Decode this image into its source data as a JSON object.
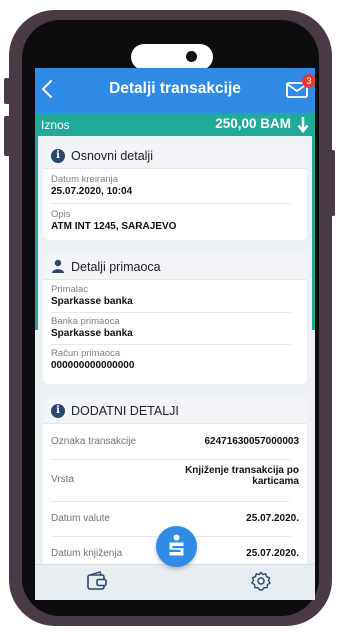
{
  "header": {
    "title": "Detalji transakcije",
    "mail_badge": "3"
  },
  "amount": {
    "label": "Iznos",
    "value": "250,00 BAM"
  },
  "basic_details": {
    "title": "Osnovni detalji",
    "created_label": "Datum kreiranja",
    "created_value": "25.07.2020, 10:04",
    "desc_label": "Opis",
    "desc_value": "ATM INT 1245, SARAJEVO"
  },
  "recipient": {
    "title": "Detalji primaoca",
    "recipient_label": "Primalac",
    "recipient_value": "Sparkasse banka",
    "bank_label": "Banka primaoca",
    "bank_value": "Sparkasse banka",
    "account_label": "Račun primaoca",
    "account_value": "000000000000000"
  },
  "additional": {
    "title": "DODATNI DETALJI",
    "rows": [
      {
        "label": "Oznaka transakcije",
        "value": "62471630057000003"
      },
      {
        "label": "Vrsta",
        "value_line1": "Knjiženje transakcija po",
        "value_line2": "karticama"
      },
      {
        "label": "Datum valute",
        "value": "25.07.2020."
      },
      {
        "label": "Datum knjiženja",
        "value": "25.07.2020."
      }
    ]
  },
  "icons": {
    "back": "chevron-left-icon",
    "mail": "mail-icon",
    "arrow": "arrow-down-icon",
    "wallet": "wallet-icon",
    "fab": "sparkasse-logo-icon",
    "settings": "gear-icon"
  },
  "colors": {
    "header": "#2f8be6",
    "amount_bar": "#21a99a",
    "badge": "#e53935",
    "phone_frame": "#4a3a46"
  }
}
